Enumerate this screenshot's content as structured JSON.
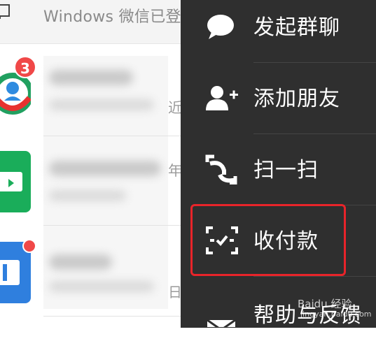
{
  "topbar": {
    "text": "Windows 微信已登"
  },
  "chat_list": {
    "badge_count": "3",
    "partial_texts": [
      "近",
      "年",
      "日"
    ]
  },
  "menu": {
    "items": [
      {
        "label": "发起群聊",
        "icon": "chat-bubble-icon"
      },
      {
        "label": "添加朋友",
        "icon": "add-friend-icon"
      },
      {
        "label": "扫一扫",
        "icon": "scan-icon"
      },
      {
        "label": "收付款",
        "icon": "payment-scan-icon",
        "highlighted": true
      },
      {
        "label": "帮助与反馈",
        "icon": "envelope-icon"
      }
    ]
  },
  "watermark": {
    "text": "Baidu 经验",
    "sub": "jingyan.baidu.com"
  },
  "colors": {
    "menu_bg": "#2f2f2f",
    "highlight": "#e8242a",
    "badge": "#f04848",
    "green_app": "#1aad5a",
    "blue_app": "#2f7fde"
  }
}
